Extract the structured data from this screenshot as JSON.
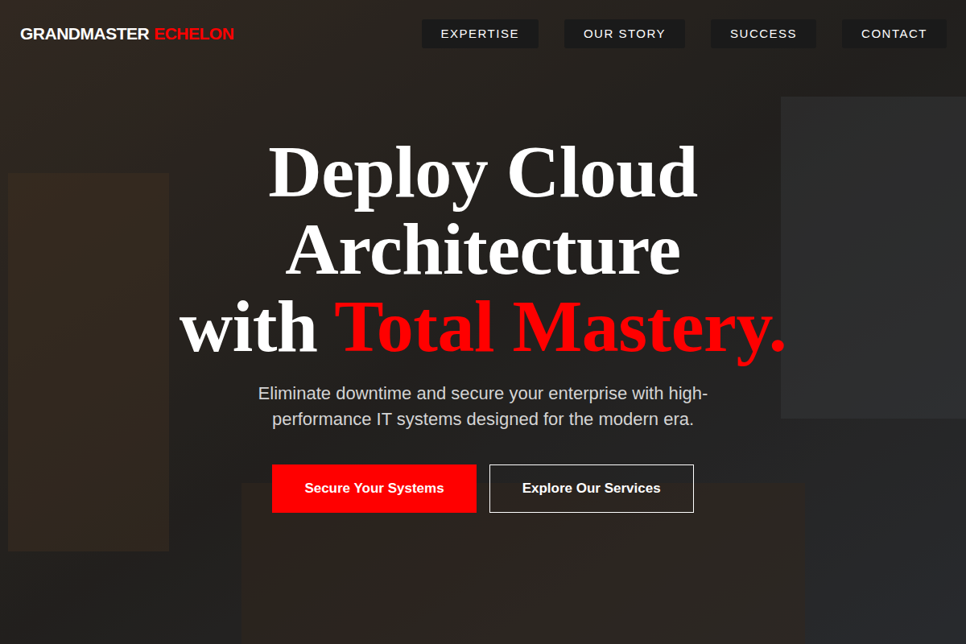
{
  "logo": {
    "primary": "GRANDMASTER",
    "accent": "ECHELON"
  },
  "nav": [
    {
      "label": "EXPERTISE"
    },
    {
      "label": "OUR STORY"
    },
    {
      "label": "SUCCESS"
    },
    {
      "label": "CONTACT"
    }
  ],
  "hero": {
    "headline": {
      "lines": [
        "Deploy Cloud",
        "Architecture"
      ],
      "lead": "with ",
      "accent": "Total Mastery."
    },
    "subtitle": "Eliminate downtime and secure your enterprise with high-performance IT systems designed for the modern era.",
    "buttons": [
      {
        "label": "Secure Your Systems",
        "kind": "primary"
      },
      {
        "label": "Explore Our Services",
        "kind": "outline"
      }
    ]
  }
}
